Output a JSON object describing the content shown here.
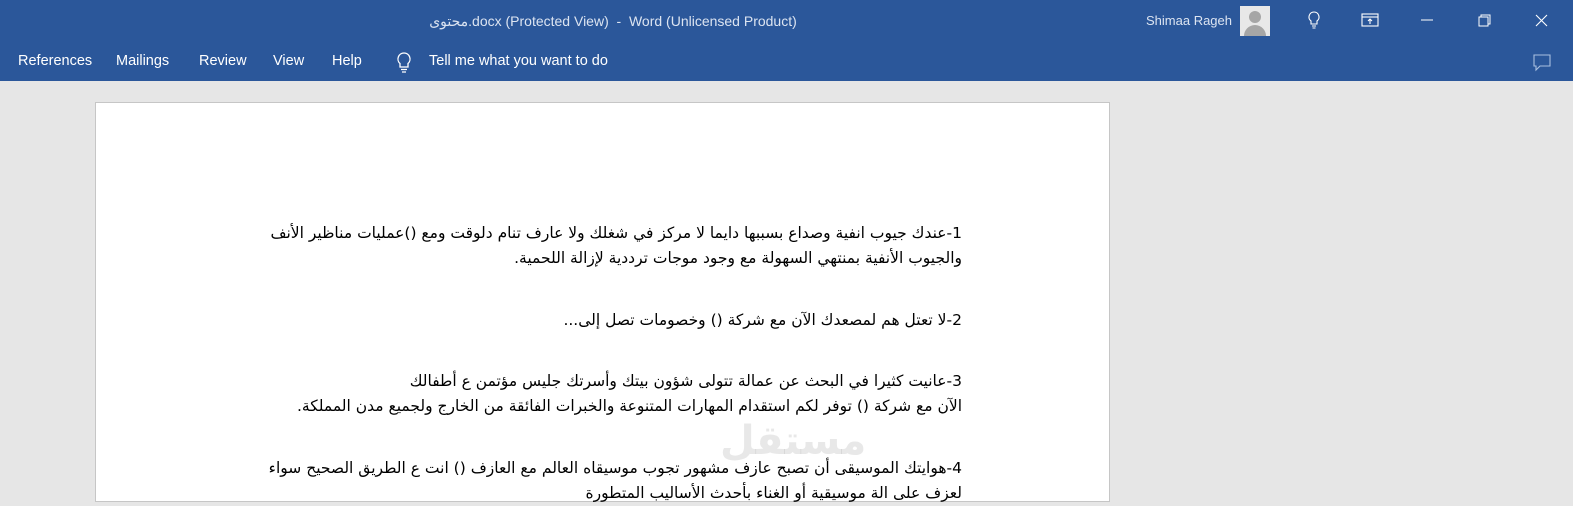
{
  "window": {
    "title": "محتوى.docx (Protected View)  -  Word (Unlicensed Product)",
    "user_name": "Shimaa Rageh"
  },
  "titlebar_icons": [
    "lightbulb-icon",
    "ribbon-display-icon",
    "minimize-icon",
    "restore-icon",
    "close-icon"
  ],
  "menu": {
    "items": [
      "References",
      "Mailings",
      "Review",
      "View",
      "Help"
    ],
    "tell_me": "Tell me what you want to do"
  },
  "document": {
    "paragraphs": [
      {
        "lines": [
          "1-عندك جيوب انفية وصداع بسببها دايما لا مركز في شغلك ولا عارف تنام دلوقت ومع ()عمليات مناظير الأنف",
          "والجيوب الأنفية بمنتهي السهولة مع وجود موجات ترددية لإزالة اللحمية."
        ]
      },
      {
        "lines": [
          "2-لا تعتل هم لمصعدك الآن مع شركة () وخصومات تصل إلى..."
        ]
      },
      {
        "lines": [
          "3-عانيت كثيرا في البحث عن عمالة تتولى شؤون بيتك وأسرتك جليس مؤتمن ع أطفالك",
          "الآن مع شركة () توفر لكم استقدام المهارات المتنوعة والخبرات الفائقة من الخارج ولجميع مدن المملكة."
        ]
      },
      {
        "lines": [
          "4-هوايتك الموسيقى أن تصبح عازف مشهور تجوب موسيقاه  العالم مع العازف () انت ع الطريق الصحيح سواء",
          "لعزف على الة موسيقية أو الغناء بأحدث الأساليب المتطورة"
        ]
      }
    ]
  },
  "watermark": "مستقل",
  "colors": {
    "titlebar_bg": "#2b579a",
    "workspace_bg": "#e6e6e6",
    "page_bg": "#ffffff"
  }
}
